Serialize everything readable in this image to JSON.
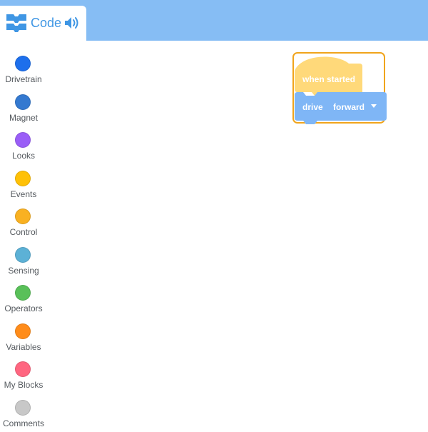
{
  "tab": {
    "label": "Code",
    "icon": "code-blocks-icon",
    "sound_icon": "speaker-icon"
  },
  "colors": {
    "top_bar": "#86bdf4",
    "tab_text": "#3f96e4",
    "hat_block": "#ffd97a",
    "drive_block": "#7fb6f6",
    "selection": "#f0a41c"
  },
  "categories": [
    {
      "label": "Drivetrain",
      "color": "#1d6fec"
    },
    {
      "label": "Magnet",
      "color": "#3479d0"
    },
    {
      "label": "Looks",
      "color": "#9a5ef7"
    },
    {
      "label": "Events",
      "color": "#ffc107"
    },
    {
      "label": "Control",
      "color": "#f9b122"
    },
    {
      "label": "Sensing",
      "color": "#5cb1d6"
    },
    {
      "label": "Operators",
      "color": "#59c059"
    },
    {
      "label": "Variables",
      "color": "#ff8c1a"
    },
    {
      "label": "My Blocks",
      "color": "#ff6680"
    },
    {
      "label": "Comments",
      "color": "#c8c8c8"
    }
  ],
  "blocks": {
    "hat_label": "when started",
    "drive_label": "drive",
    "drive_direction": "forward"
  }
}
